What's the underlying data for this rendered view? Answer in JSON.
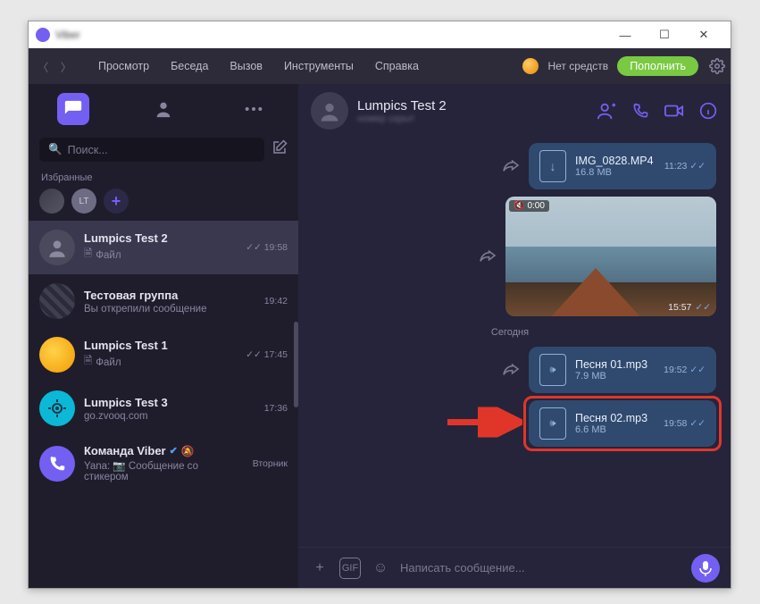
{
  "window": {
    "title": "Viber"
  },
  "menu": {
    "items": [
      "Просмотр",
      "Беседа",
      "Вызов",
      "Инструменты",
      "Справка"
    ],
    "no_funds": "Нет средств",
    "fill": "Пополнить"
  },
  "sidebar": {
    "search_placeholder": "Поиск...",
    "favorites_label": "Избранные",
    "pins": [
      {
        "label": "",
        "cls": "img1"
      },
      {
        "label": "LT",
        "cls": "lt"
      }
    ],
    "chats": [
      {
        "name": "Lumpics Test 2",
        "sub_icon": "📄",
        "sub": "Файл",
        "status": "✓✓",
        "time": "19:58",
        "avatar": "plain",
        "selected": true
      },
      {
        "name": "Тестовая группа",
        "sub": "Вы открепили сообщение",
        "time": "19:42",
        "avatar": "photo1"
      },
      {
        "name": "Lumpics Test 1",
        "sub_icon": "📄",
        "sub": "Файл",
        "status": "✓✓",
        "time": "17:45",
        "avatar": "orange"
      },
      {
        "name": "Lumpics Test 3",
        "sub": "go.zvooq.com",
        "time": "17:36",
        "avatar": "cyan"
      },
      {
        "name": "Команда Viber",
        "verified": true,
        "muted": true,
        "sub": "Yana: 📷 Сообщение со стикером",
        "time": "Вторник",
        "avatar": "viber"
      }
    ]
  },
  "chat": {
    "header": {
      "name": "Lumpics Test 2",
      "sub": "номер скрыт"
    },
    "file_msg": {
      "name": "IMG_0828.MP4",
      "size": "16.8 MB",
      "time": "11:23"
    },
    "video": {
      "top": "0:00",
      "bot": "15:57"
    },
    "day": "Сегодня",
    "song1": {
      "name": "Песня 01.mp3",
      "size": "7.9 MB",
      "time": "19:52"
    },
    "song2": {
      "name": "Песня 02.mp3",
      "size": "6.6 MB",
      "time": "19:58"
    },
    "compose_placeholder": "Написать сообщение..."
  }
}
